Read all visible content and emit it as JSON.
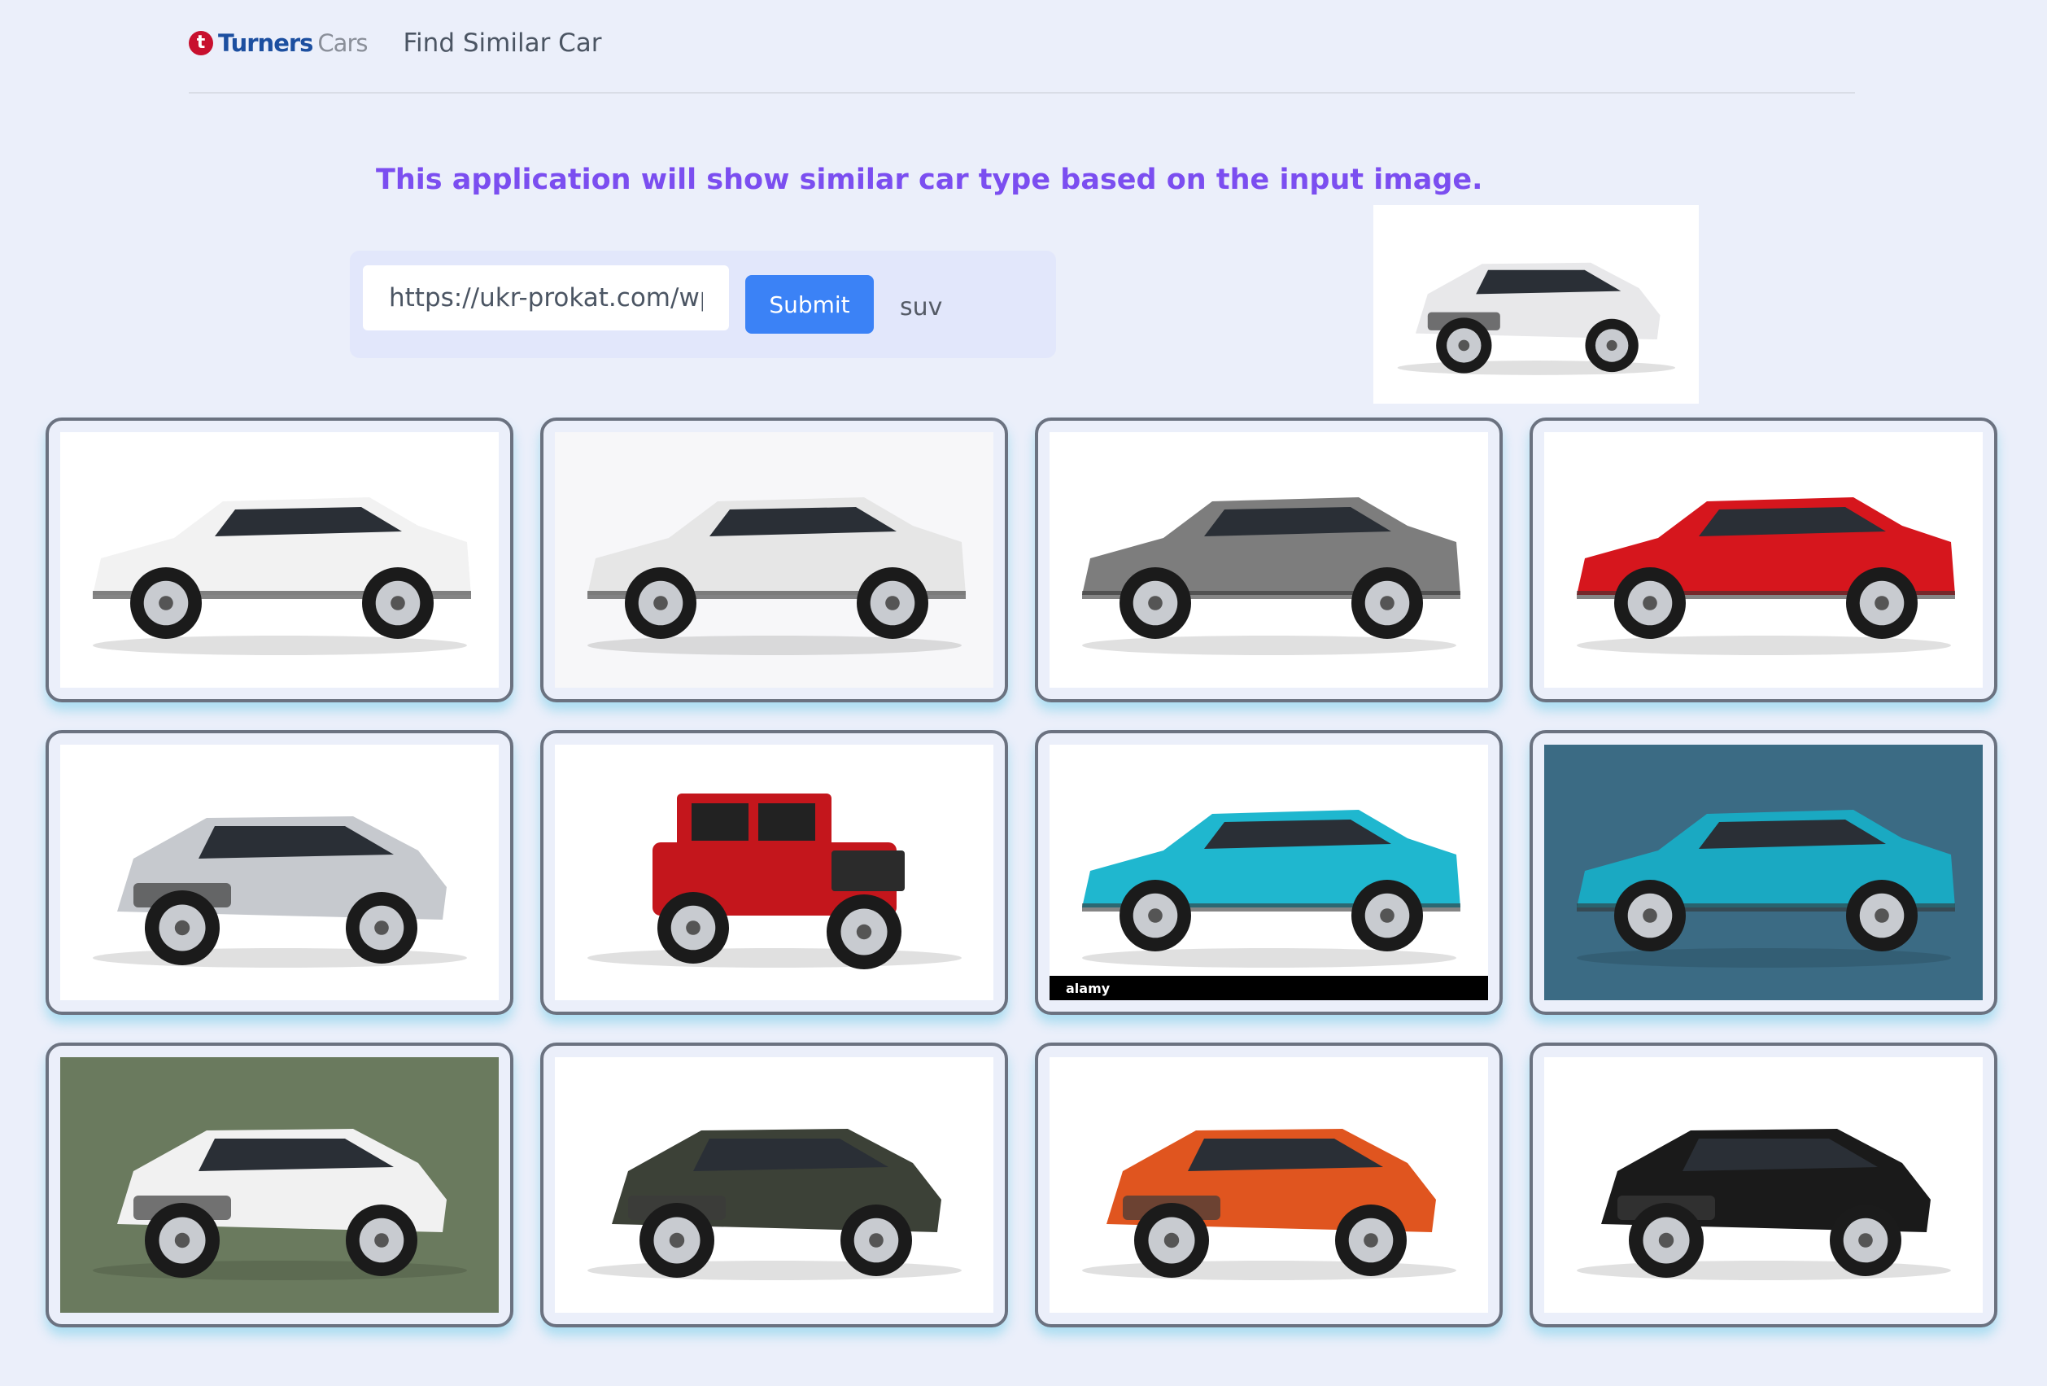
{
  "header": {
    "brand_name_1": "Turners",
    "brand_name_2": "Cars",
    "brand_mark": "t",
    "nav_link": "Find Similar Car"
  },
  "intro_text": "This application will show similar car type based on the input image.",
  "form": {
    "url_value": "https://ukr-prokat.com/wp",
    "submit_label": "Submit",
    "result_label": "suv"
  },
  "input_image": {
    "alt": "white SUV",
    "color": "#e8e8ea"
  },
  "results": [
    {
      "alt": "white suv side",
      "body": "#f2f2f2",
      "bg": "#ffffff",
      "style": "side"
    },
    {
      "alt": "white suv illustration",
      "body": "#e6e6e6",
      "bg": "#f7f7f9",
      "style": "side"
    },
    {
      "alt": "grey suv side",
      "body": "#7d7d7d",
      "bg": "#ffffff",
      "style": "side"
    },
    {
      "alt": "red suv side",
      "body": "#d6161d",
      "bg": "#ffffff",
      "style": "side"
    },
    {
      "alt": "silver suv",
      "body": "#c6c9ce",
      "bg": "#ffffff",
      "style": "front"
    },
    {
      "alt": "red jeep",
      "body": "#c4161c",
      "bg": "#ffffff",
      "style": "jeep"
    },
    {
      "alt": "cyan suv",
      "body": "#1fb7cf",
      "bg": "#ffffff",
      "style": "side",
      "watermark": "alamy"
    },
    {
      "alt": "concept suv",
      "body": "#1aa9c2",
      "bg": "#3b6b84",
      "style": "side"
    },
    {
      "alt": "white suv outdoors",
      "body": "#f1f1f1",
      "bg": "#6a7a5e",
      "style": "front"
    },
    {
      "alt": "dark suv",
      "body": "#3c4137",
      "bg": "#ffffff",
      "style": "front"
    },
    {
      "alt": "orange suv",
      "body": "#e0551f",
      "bg": "#ffffff",
      "style": "front"
    },
    {
      "alt": "black suv",
      "body": "#1a1a1a",
      "bg": "#ffffff",
      "style": "front"
    }
  ]
}
